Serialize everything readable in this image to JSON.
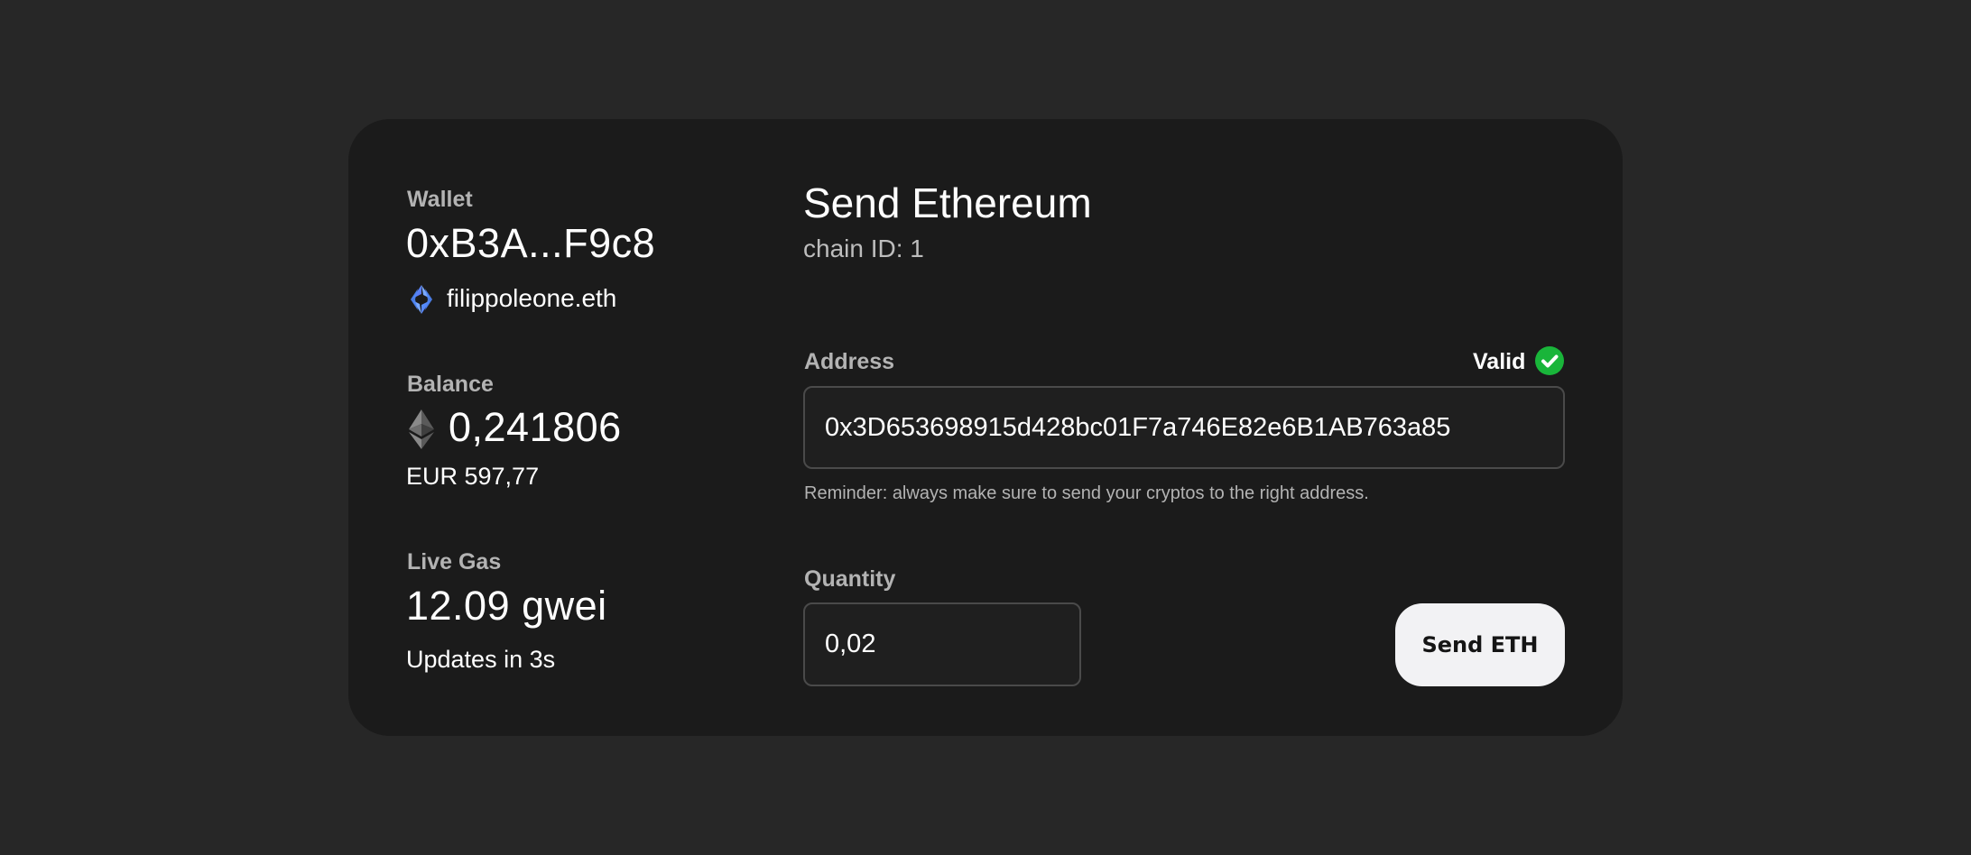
{
  "wallet": {
    "label": "Wallet",
    "address": "0xB3A...F9c8",
    "ens_icon": "ens-icon",
    "ens_name": "filippoleone.eth"
  },
  "balance": {
    "label": "Balance",
    "icon": "ethereum-icon",
    "amount": "0,241806",
    "fiat": "EUR 597,77"
  },
  "gas": {
    "label": "Live Gas",
    "value": "12.09 gwei",
    "update_text": "Updates in 3s"
  },
  "form": {
    "title": "Send Ethereum",
    "chain": "chain ID: 1",
    "address_label": "Address",
    "valid_label": "Valid",
    "valid_icon": "check-circle-icon",
    "address_value": "0x3D653698915d428bc01F7a746E82e6B1AB763a85",
    "reminder": "Reminder: always make sure to send your cryptos to the right address.",
    "quantity_label": "Quantity",
    "quantity_value": "0,02",
    "send_label": "Send ETH"
  },
  "colors": {
    "background": "#272727",
    "card": "#1b1b1b",
    "valid_green": "#19b53a",
    "button": "#f2f2f4"
  }
}
